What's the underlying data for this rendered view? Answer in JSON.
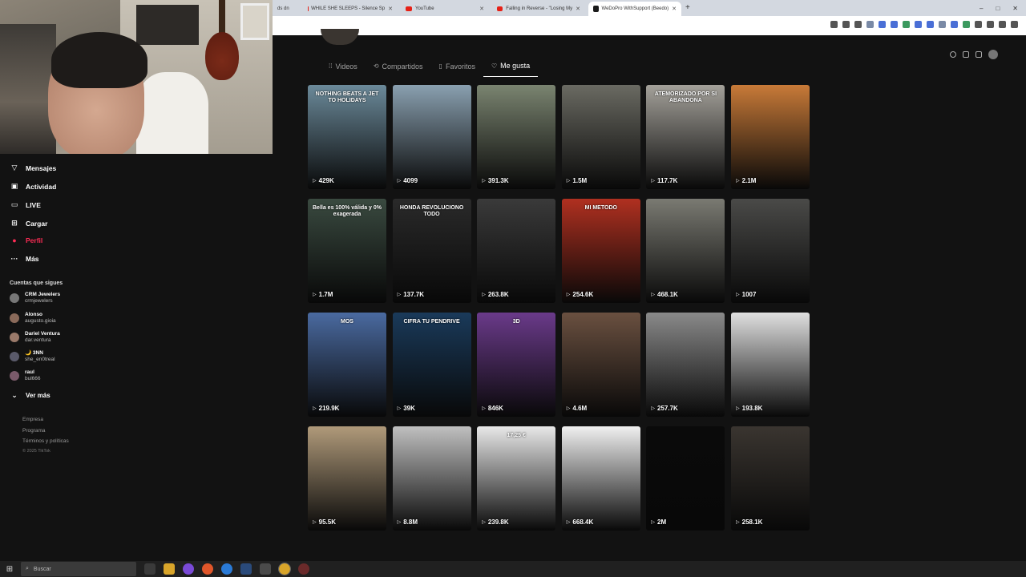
{
  "browser": {
    "tabs": [
      {
        "title": "WHILE SHE SLEEPS - Silence Sp",
        "icon": "youtube-icon"
      },
      {
        "title": "YouTube",
        "icon": "youtube-icon"
      },
      {
        "title": "Falling in Reverse - \"Losing My",
        "icon": "youtube-icon"
      },
      {
        "title": "WeDoPro WithSupport (Beedo)",
        "icon": "tiktok-icon",
        "active": true
      }
    ],
    "new_tab": "+",
    "window_controls": [
      "–",
      "□",
      "✕"
    ]
  },
  "profile_tabs": [
    {
      "label": "Videos",
      "icon": "grid-icon"
    },
    {
      "label": "Compartidos",
      "icon": "repost-icon"
    },
    {
      "label": "Favoritos",
      "icon": "bookmark-icon"
    },
    {
      "label": "Me gusta",
      "icon": "heart-icon",
      "active": true
    }
  ],
  "videos": [
    {
      "views": "429K",
      "caption": "NOTHING BEATS A JET TO HOLIDAYS",
      "bg": "#6b8a9a"
    },
    {
      "views": "4099",
      "caption": "",
      "bg": "#8aa0b0"
    },
    {
      "views": "391.3K",
      "caption": "",
      "bg": "#7a8470"
    },
    {
      "views": "1.5M",
      "caption": "",
      "bg": "#6a6a62"
    },
    {
      "views": "117.7K",
      "caption": "ATEMORIZADO POR SI ABANDONA",
      "bg": "#a4a19a"
    },
    {
      "views": "2.1M",
      "caption": "",
      "bg": "#c87a38"
    },
    {
      "views": "1.7M",
      "caption": "Bella es 100% válida y 0% exagerada",
      "bg": "#3a4a40"
    },
    {
      "views": "137.7K",
      "caption": "HONDA REVOLUCIONO TODO",
      "bg": "#2a2a2a"
    },
    {
      "views": "263.8K",
      "caption": "",
      "bg": "#3a3a3a"
    },
    {
      "views": "254.6K",
      "caption": "MI METODO",
      "bg": "#b03020"
    },
    {
      "views": "468.1K",
      "caption": "",
      "bg": "#7a7a72"
    },
    {
      "views": "1007",
      "caption": "",
      "bg": "#4a4a48"
    },
    {
      "views": "219.9K",
      "caption": "MOS",
      "bg": "#4a6aa0"
    },
    {
      "views": "39K",
      "caption": "CIFRA TU PENDRIVE",
      "bg": "#1a3a5a"
    },
    {
      "views": "846K",
      "caption": "3D",
      "bg": "#6a3a8a"
    },
    {
      "views": "4.6M",
      "caption": "",
      "bg": "#6a5040"
    },
    {
      "views": "257.7K",
      "caption": "",
      "bg": "#8a8a8a"
    },
    {
      "views": "193.8K",
      "caption": "",
      "bg": "#e0e0e0"
    },
    {
      "views": "95.5K",
      "caption": "",
      "bg": "#b09a7a"
    },
    {
      "views": "8.8M",
      "caption": "",
      "bg": "#c0c0c0"
    },
    {
      "views": "239.8K",
      "caption": "17,25 €",
      "bg": "#e8e8e8"
    },
    {
      "views": "668.4K",
      "caption": "",
      "bg": "#f0f0f0"
    },
    {
      "views": "2M",
      "caption": "",
      "bg": "#0a0a0a"
    },
    {
      "views": "258.1K",
      "caption": "",
      "bg": "#3a3530"
    }
  ],
  "sidebar": {
    "nav": [
      {
        "label": "Mensajes",
        "icon": "send-icon"
      },
      {
        "label": "Actividad",
        "icon": "inbox-icon"
      },
      {
        "label": "LIVE",
        "icon": "live-icon"
      },
      {
        "label": "Cargar",
        "icon": "upload-icon"
      },
      {
        "label": "Perfil",
        "icon": "avatar-icon",
        "active": true
      },
      {
        "label": "Más",
        "icon": "more-icon"
      }
    ],
    "following_title": "Cuentas que sigues",
    "following": [
      {
        "name": "CRM Jewelers",
        "user": "crmjewelers"
      },
      {
        "name": "Alonso",
        "user": "augusto.gioia"
      },
      {
        "name": "Dariel Ventura",
        "user": "dar.ventura"
      },
      {
        "name": "🌙 3NN",
        "user": "she_en0treal"
      },
      {
        "name": "raul",
        "user": "bul666"
      }
    ],
    "see_more": "Ver más",
    "footer": [
      "Empresa",
      "Programa",
      "Términos y políticas"
    ],
    "copyright": "© 2025 TikTok"
  },
  "taskbar": {
    "search_placeholder": "Buscar"
  }
}
